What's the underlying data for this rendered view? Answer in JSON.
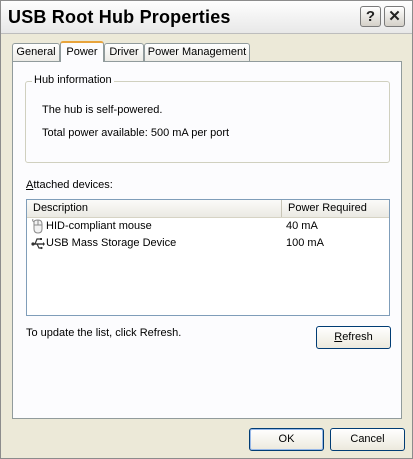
{
  "window": {
    "title": "USB Root Hub Properties"
  },
  "titlebar": {
    "help_glyph": "?",
    "close_glyph": "✕"
  },
  "tabs": [
    {
      "label": "General"
    },
    {
      "label": "Power"
    },
    {
      "label": "Driver"
    },
    {
      "label": "Power Management"
    }
  ],
  "active_tab": "Power",
  "hub_info": {
    "legend": "Hub information",
    "self_powered": "The hub is self-powered.",
    "total_power": "Total power available:  500 mA per port"
  },
  "attached": {
    "label_accel": "A",
    "label_rest": "ttached devices:",
    "columns": [
      "Description",
      "Power Required"
    ],
    "rows": [
      {
        "description": "HID-compliant mouse",
        "power": "40 mA",
        "icon": "mouse-icon"
      },
      {
        "description": "USB Mass Storage Device",
        "power": "100 mA",
        "icon": "usb-icon"
      }
    ]
  },
  "refresh": {
    "hint": "To update the list, click Refresh.",
    "button_accel": "R",
    "button_rest": "efresh"
  },
  "buttons": {
    "ok": "OK",
    "cancel": "Cancel"
  }
}
